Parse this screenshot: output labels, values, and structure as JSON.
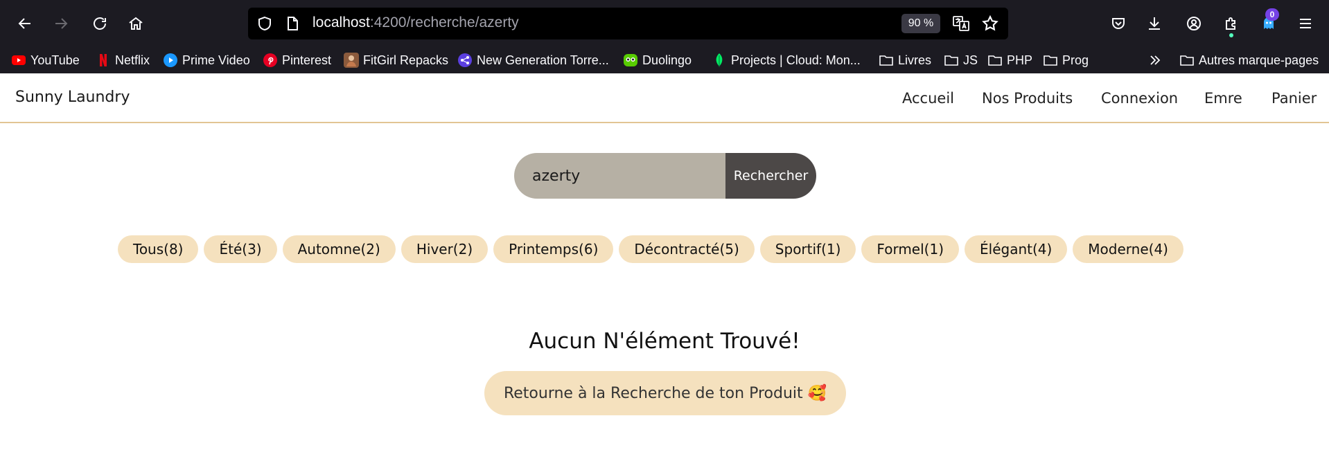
{
  "browser": {
    "url_host": "localhost",
    "url_path": ":4200/recherche/azerty",
    "zoom": "90 %",
    "extension_badge": "0",
    "bookmarks": [
      {
        "label": "YouTube",
        "icon": "youtube-icon",
        "color": "#ff0000"
      },
      {
        "label": "Netflix",
        "icon": "netflix-icon",
        "color": "#e50914"
      },
      {
        "label": "Prime Video",
        "icon": "prime-video-icon",
        "color": "#1a98ff"
      },
      {
        "label": "Pinterest",
        "icon": "pinterest-icon",
        "color": "#e60023"
      },
      {
        "label": "FitGirl Repacks",
        "icon": "fitgirl-icon",
        "color": "#8b5a3c"
      },
      {
        "label": "New Generation Torre...",
        "icon": "torrent-icon",
        "color": "#5b3fe0"
      },
      {
        "label": "Duolingo",
        "icon": "duolingo-icon",
        "color": "#58cc02"
      },
      {
        "label": "Projects | Cloud: Mon...",
        "icon": "mongodb-leaf-icon",
        "color": "#00ed64"
      },
      {
        "label": "Livres",
        "icon": "folder-icon",
        "color": "#fbfbfe"
      },
      {
        "label": "JS",
        "icon": "folder-icon",
        "color": "#fbfbfe"
      },
      {
        "label": "PHP",
        "icon": "folder-icon",
        "color": "#fbfbfe"
      },
      {
        "label": "Prog",
        "icon": "folder-icon",
        "color": "#fbfbfe"
      }
    ],
    "other_bookmarks": "Autres marque-pages"
  },
  "site": {
    "brand": "Sunny Laundry",
    "nav": [
      "Accueil",
      "Nos Produits",
      "Connexion",
      "Emre",
      "Panier"
    ]
  },
  "search": {
    "value": "azerty",
    "button": "Rechercher"
  },
  "filters": [
    "Tous(8)",
    "Été(3)",
    "Automne(2)",
    "Hiver(2)",
    "Printemps(6)",
    "Décontracté(5)",
    "Sportif(1)",
    "Formel(1)",
    "Élégant(4)",
    "Moderne(4)"
  ],
  "empty_state": {
    "title": "Aucun N'élément Trouvé!",
    "back_button": "Retourne à la Recherche de ton Produit 🥰"
  },
  "colors": {
    "accent": "#f5e1be",
    "header_border": "#e2c594",
    "search_bg": "#b6b0a4",
    "search_button": "#4c4847"
  }
}
